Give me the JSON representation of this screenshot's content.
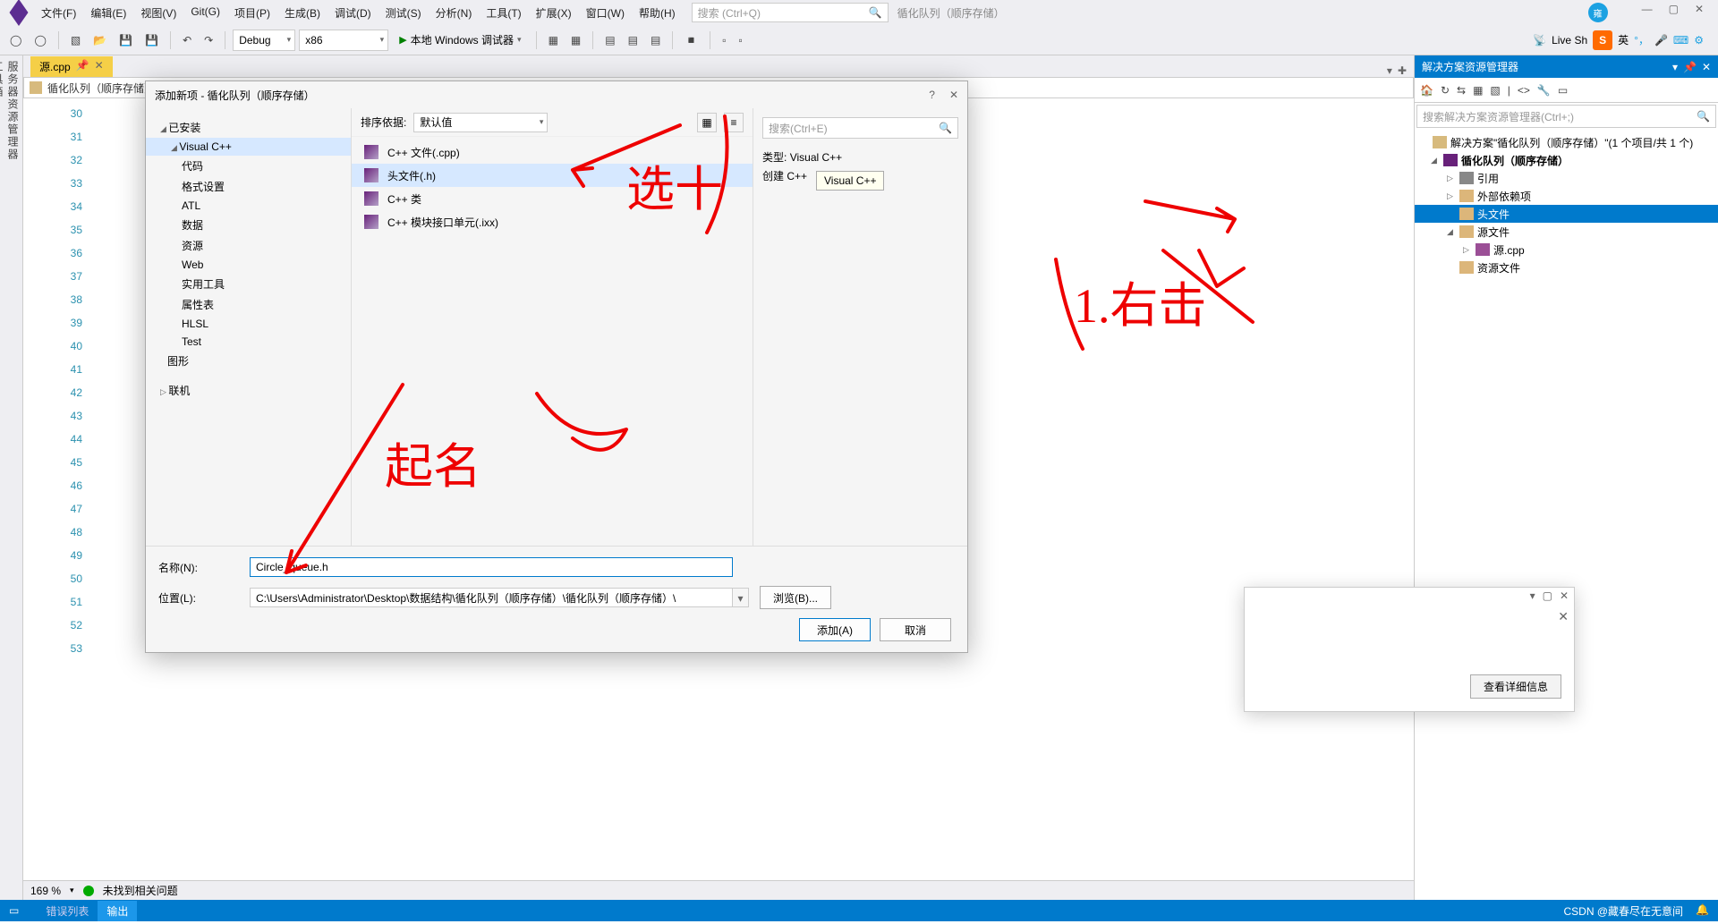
{
  "menu": {
    "items": [
      "文件(F)",
      "编辑(E)",
      "视图(V)",
      "Git(G)",
      "项目(P)",
      "生成(B)",
      "调试(D)",
      "测试(S)",
      "分析(N)",
      "工具(T)",
      "扩展(X)",
      "窗口(W)",
      "帮助(H)"
    ],
    "search_placeholder": "搜索 (Ctrl+Q)",
    "context": "循化队列（顺序存储）",
    "user": "雍"
  },
  "window_buttons": [
    "—",
    "▢",
    "✕"
  ],
  "toolbar": {
    "config": "Debug",
    "platform": "x86",
    "run": "本地 Windows 调试器",
    "liveshare": "Live Sh",
    "ime_lang": "英"
  },
  "tabs": {
    "active": "源.cpp"
  },
  "crumb": "循化队列（顺序存储）",
  "gutter": {
    "start": 30,
    "end": 53
  },
  "zoom": {
    "value": "169 %",
    "msg": "未找到相关问题"
  },
  "solution": {
    "panel_title": "解决方案资源管理器",
    "search_placeholder": "搜索解决方案资源管理器(Ctrl+;)",
    "root": "解决方案\"循化队列（顺序存储）\"(1 个项目/共 1 个)",
    "project": "循化队列（顺序存储）",
    "refs": "引用",
    "ext_deps": "外部依赖项",
    "headers": "头文件",
    "sources": "源文件",
    "src_file": "源.cpp",
    "resources": "资源文件"
  },
  "dialog": {
    "title": "添加新项 - 循化队列（顺序存储）",
    "installed": "已安装",
    "vcpp": "Visual C++",
    "cats": [
      "代码",
      "格式设置",
      "ATL",
      "数据",
      "资源",
      "Web",
      "实用工具",
      "属性表",
      "HLSL",
      "Test"
    ],
    "graphics": "图形",
    "online": "联机",
    "sort_label": "排序依据:",
    "sort_value": "默认值",
    "templates": [
      "C++ 文件(.cpp)",
      "头文件(.h)",
      "C++ 类",
      "C++ 模块接口单元(.ixx)"
    ],
    "selected_idx": 1,
    "search_placeholder": "搜索(Ctrl+E)",
    "type_label": "类型:",
    "type_value": "Visual C++",
    "create_label": "创建 C++",
    "tooltip": "Visual C++",
    "name_label": "名称(N):",
    "name_value": "Circle_queue.h",
    "loc_label": "位置(L):",
    "loc_value": "C:\\Users\\Administrator\\Desktop\\数据结构\\循化队列（顺序存储）\\循化队列（顺序存储）\\",
    "browse": "浏览(B)...",
    "add": "添加(A)",
    "cancel": "取消"
  },
  "status": {
    "tabs": [
      "错误列表",
      "输出"
    ],
    "right": "CSDN @藏春尽在无意间"
  },
  "prop_popup": {
    "btn": "查看详细信息"
  },
  "annotations": {
    "a1": "选十",
    "a2": "起名",
    "a3": "1.右击"
  }
}
